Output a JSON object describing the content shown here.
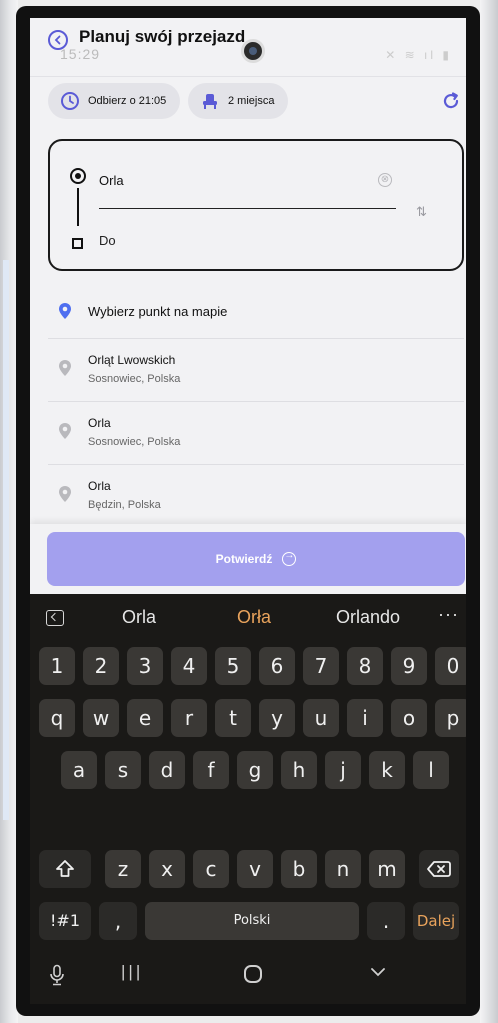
{
  "header": {
    "title": "Planuj swój przejazd",
    "status_time": "15:29",
    "status_icons": "✕ ≋ ıl ▮"
  },
  "chips": {
    "pickup": {
      "label": "Odbierz o 21:05",
      "icon": "clock-icon"
    },
    "seats": {
      "label": "2 miejsca",
      "icon": "seat-icon"
    },
    "refresh_icon": "refresh-icon"
  },
  "route": {
    "from_value": "Orla",
    "to_placeholder": "Do",
    "clear_icon": "⊗",
    "swap_icon": "⇅"
  },
  "map_pick": {
    "label": "Wybierz punkt na mapie"
  },
  "suggestions": [
    {
      "name": "Orląt Lwowskich",
      "sub": "Sosnowiec, Polska"
    },
    {
      "name": "Orla",
      "sub": "Sosnowiec, Polska"
    },
    {
      "name": "Orla",
      "sub": "Będzin, Polska"
    }
  ],
  "confirm": {
    "label": "Potwierdź"
  },
  "keyboard": {
    "suggestions": [
      "Orla",
      "Orła",
      "Orlando"
    ],
    "more": "···",
    "row1": [
      "1",
      "2",
      "3",
      "4",
      "5",
      "6",
      "7",
      "8",
      "9",
      "0"
    ],
    "row2": [
      "q",
      "w",
      "e",
      "r",
      "t",
      "y",
      "u",
      "i",
      "o",
      "p"
    ],
    "row3": [
      "a",
      "s",
      "d",
      "f",
      "g",
      "h",
      "j",
      "k",
      "l"
    ],
    "row4": [
      "z",
      "x",
      "c",
      "v",
      "b",
      "n",
      "m"
    ],
    "symbols": "!#1",
    "comma": ",",
    "space": "Polski",
    "period": ".",
    "enter": "Dalej"
  },
  "colors": {
    "accent": "#5b5bd6",
    "confirm_bg": "#a3a0ee",
    "kbd_highlight": "#e9a35c",
    "pin_blue": "#4f6ff0",
    "pin_grey": "#b9b9bd"
  }
}
